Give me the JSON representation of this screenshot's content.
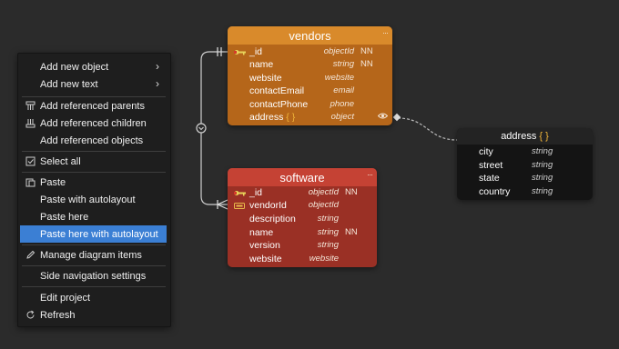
{
  "menu": {
    "items": [
      {
        "label": "Add new object",
        "arrow": "›",
        "icon": ""
      },
      {
        "label": "Add new text",
        "arrow": "›",
        "icon": ""
      },
      {
        "label": "Add referenced parents",
        "icon": "parents-icon"
      },
      {
        "label": "Add referenced children",
        "icon": "children-icon"
      },
      {
        "label": "Add referenced objects",
        "icon": ""
      },
      {
        "label": "Select all",
        "icon": "checkbox-icon"
      },
      {
        "label": "Paste",
        "icon": "paste-icon"
      },
      {
        "label": "Paste with autolayout",
        "icon": ""
      },
      {
        "label": "Paste here",
        "icon": ""
      },
      {
        "label": "Paste here with autolayout",
        "icon": "",
        "selected": true
      },
      {
        "label": "Manage diagram items",
        "icon": "pencil-icon"
      },
      {
        "label": "Side navigation settings",
        "icon": ""
      },
      {
        "label": "Edit project",
        "icon": ""
      },
      {
        "label": "Refresh",
        "icon": "refresh-icon"
      }
    ]
  },
  "vendors": {
    "title": "vendors",
    "dots": "···",
    "fields": [
      {
        "name": "_id",
        "type": "objectId",
        "nn": "NN",
        "key": "pk"
      },
      {
        "name": "name",
        "type": "string",
        "nn": "NN"
      },
      {
        "name": "website",
        "type": "website",
        "nn": ""
      },
      {
        "name": "contactEmail",
        "type": "email",
        "nn": ""
      },
      {
        "name": "contactPhone",
        "type": "phone",
        "nn": ""
      },
      {
        "name": "address",
        "brace": "{ }",
        "type": "object",
        "nn": ""
      }
    ],
    "colors": {
      "header": "#d98a2b",
      "body": "#b5661a"
    }
  },
  "software": {
    "title": "software",
    "dots": "···",
    "fields": [
      {
        "name": "_id",
        "type": "objectId",
        "nn": "NN",
        "key": "pk"
      },
      {
        "name": "vendorId",
        "type": "objectId",
        "nn": "",
        "key": "fk"
      },
      {
        "name": "description",
        "type": "string",
        "nn": ""
      },
      {
        "name": "name",
        "type": "string",
        "nn": "NN"
      },
      {
        "name": "version",
        "type": "string",
        "nn": ""
      },
      {
        "name": "website",
        "type": "website",
        "nn": ""
      }
    ],
    "colors": {
      "header": "#c54234",
      "body": "#9a3025"
    }
  },
  "address": {
    "title": "address",
    "brace": "{ }",
    "fields": [
      {
        "name": "city",
        "type": "string"
      },
      {
        "name": "street",
        "type": "string"
      },
      {
        "name": "state",
        "type": "string"
      },
      {
        "name": "country",
        "type": "string"
      }
    ]
  }
}
